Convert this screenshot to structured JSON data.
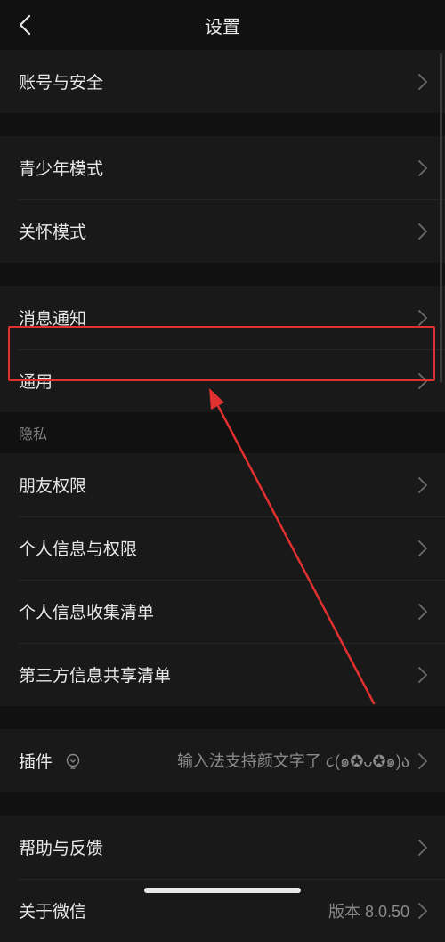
{
  "header": {
    "title": "设置"
  },
  "groups": {
    "account": {
      "items": [
        {
          "label": "账号与安全"
        }
      ]
    },
    "modes": {
      "items": [
        {
          "label": "青少年模式"
        },
        {
          "label": "关怀模式"
        }
      ]
    },
    "notify": {
      "items": [
        {
          "label": "消息通知"
        },
        {
          "label": "通用"
        }
      ]
    },
    "privacy": {
      "section_label": "隐私",
      "items": [
        {
          "label": "朋友权限"
        },
        {
          "label": "个人信息与权限"
        },
        {
          "label": "个人信息收集清单"
        },
        {
          "label": "第三方信息共享清单"
        }
      ]
    },
    "plugins": {
      "items": [
        {
          "label": "插件",
          "value": "输入法支持颜文字了 ૮(๑✪ᴗ✪๑)ა"
        }
      ]
    },
    "help": {
      "items": [
        {
          "label": "帮助与反馈"
        },
        {
          "label": "关于微信",
          "value": "版本 8.0.50"
        }
      ]
    }
  },
  "colors": {
    "background": "#111111",
    "group_background": "#191919",
    "annotation_red": "#e03030"
  },
  "icons": {
    "back": "chevron-left-icon",
    "row_chevron": "chevron-right-icon",
    "plugin": "bulb-icon"
  },
  "annotation": {
    "highlighted_item": "通用"
  }
}
